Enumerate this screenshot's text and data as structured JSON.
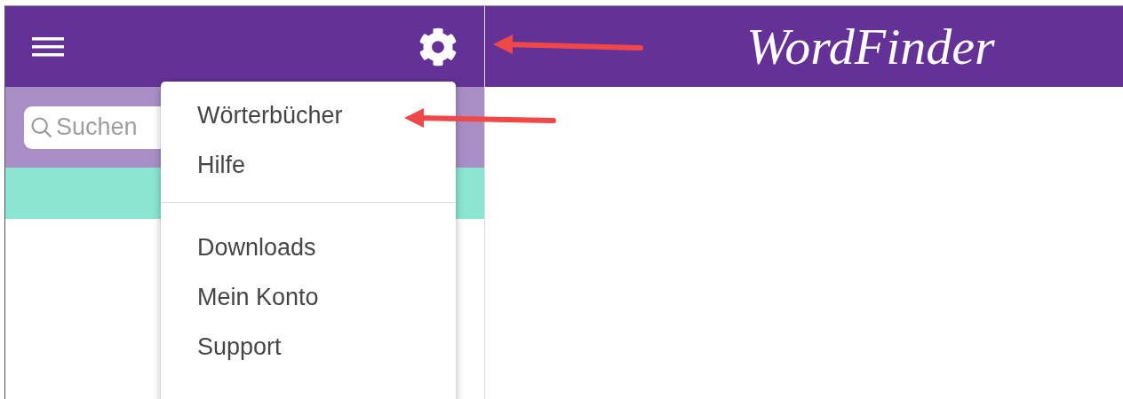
{
  "search": {
    "placeholder": "Suchen"
  },
  "app_title": "WordFinder",
  "settings_menu": {
    "sections": [
      {
        "items": [
          "Wörterbücher",
          "Hilfe"
        ]
      },
      {
        "items": [
          "Downloads",
          "Mein Konto",
          "Support"
        ]
      }
    ]
  }
}
